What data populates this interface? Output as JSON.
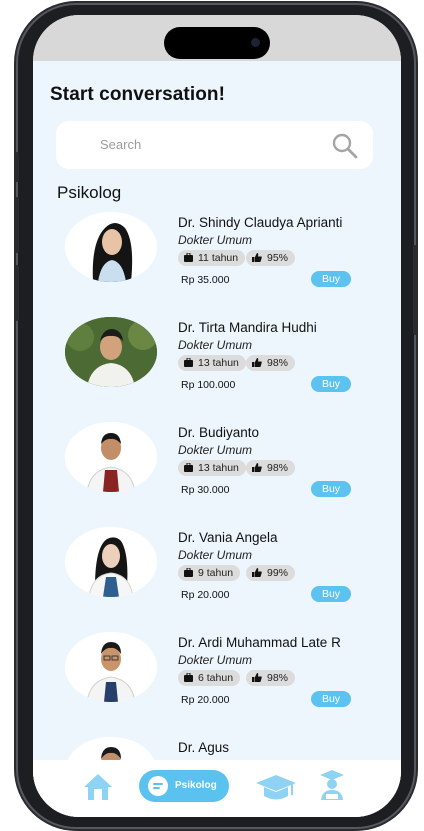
{
  "header": {
    "title": "Start conversation!"
  },
  "search": {
    "placeholder": "Search"
  },
  "section_title": "Psikolog",
  "doctors": [
    {
      "name": "Dr. Shindy Claudya Aprianti",
      "role": "Dokter Umum",
      "experience": "11 tahun",
      "rating": "95%",
      "price": "Rp 35.000",
      "buy_label": "Buy"
    },
    {
      "name": "Dr. Tirta Mandira Hudhi",
      "role": "Dokter Umum",
      "experience": "13 tahun",
      "rating": "98%",
      "price": "Rp 100.000",
      "buy_label": "Buy"
    },
    {
      "name": "Dr. Budiyanto",
      "role": "Dokter Umum",
      "experience": "13 tahun",
      "rating": "98%",
      "price": "Rp 30.000",
      "buy_label": "Buy"
    },
    {
      "name": "Dr. Vania Angela",
      "role": "Dokter Umum",
      "experience": "9 tahun",
      "rating": "99%",
      "price": "Rp 20.000",
      "buy_label": "Buy"
    },
    {
      "name": "Dr. Ardi Muhammad Late R",
      "role": "Dokter Umum",
      "experience": "6 tahun",
      "rating": "98%",
      "price": "Rp 20.000",
      "buy_label": "Buy"
    },
    {
      "name": "Dr. Agus"
    }
  ],
  "bottom_nav": {
    "items": [
      {
        "icon": "home-icon"
      },
      {
        "icon": "chat-icon",
        "label": "Psikolog",
        "active": true
      },
      {
        "icon": "graduation-cap-icon"
      },
      {
        "icon": "graduate-icon"
      }
    ]
  },
  "colors": {
    "accent": "#5bc2ef",
    "background": "#eef6fd",
    "chip": "#dcdcdc"
  }
}
